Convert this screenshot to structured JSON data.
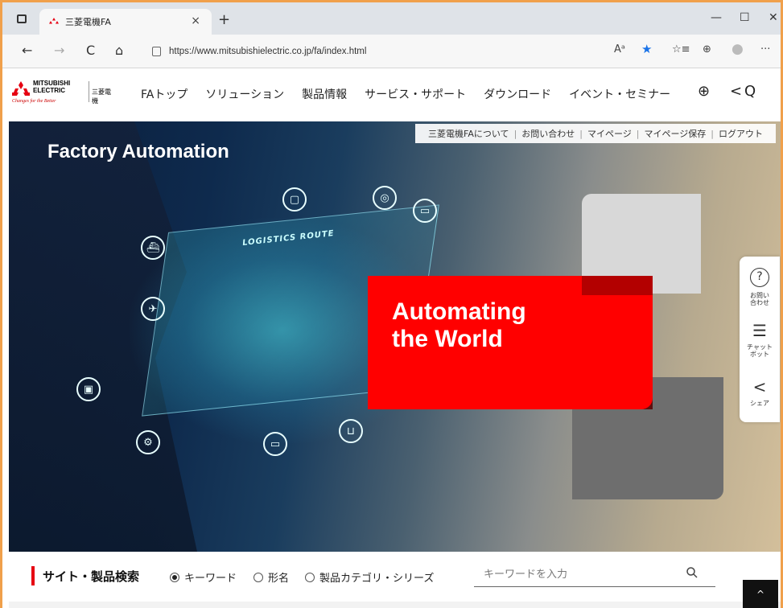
{
  "browser": {
    "tab_title": "三菱電機FA",
    "tab_close": "×",
    "new_tab": "+",
    "url": "https://www.mitsubishielectric.co.jp/fa/index.html",
    "nav": {
      "back": "←",
      "forward": "→",
      "reload": "C",
      "home": "⌂"
    },
    "window": {
      "minimize": "—",
      "maximize": "☐",
      "close": "✕"
    },
    "addr_icons": {
      "read_aloud": "Aᵃ",
      "favorite": "★",
      "favorites": "☆≡",
      "collections": "⊕",
      "profile": "●",
      "more": "···"
    }
  },
  "site": {
    "logo_text_line1": "MITSUBISHI",
    "logo_text_line2": "ELECTRIC",
    "logo_tagline": "Changes for the Better",
    "logo_jp": "三菱電機",
    "nav": [
      "FAトップ",
      "ソリューション",
      "製品情報",
      "サービス・サポート",
      "ダウンロード",
      "イベント・セミナー"
    ],
    "header_icons": {
      "globe": "⊕",
      "back": "<",
      "search": "Q"
    }
  },
  "hero": {
    "title": "Factory Automation",
    "tagline_line1": "Automating",
    "tagline_line2": "the World",
    "image_text": "LOGISTICS ROUTE",
    "utility_links": [
      "三菱電機FAについて",
      "お問い合わせ",
      "マイページ",
      "マイページ保存",
      "ログアウト"
    ],
    "utility_separator": "|"
  },
  "side_float": {
    "inquiry_label": "お問い合わせ",
    "inquiry_icon": "?",
    "chatbot_label": "チャットボット",
    "chatbot_icon": "☰",
    "share_label": "シェア",
    "share_icon": "<"
  },
  "search": {
    "heading": "サイト・製品検索",
    "options": [
      "キーワード",
      "形名",
      "製品カテゴリ・シリーズ"
    ],
    "selected_option": "キーワード",
    "placeholder": "キーワードを入力",
    "value": "",
    "search_icon": "🔍",
    "to_top": "^"
  },
  "colors": {
    "brand_red": "#ff0000",
    "accent_red": "#e60012",
    "frame_orange": "#f0a04b"
  }
}
